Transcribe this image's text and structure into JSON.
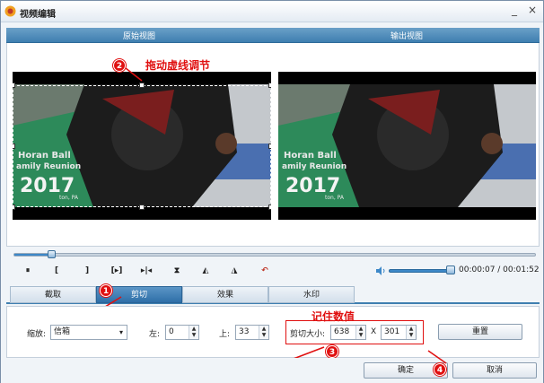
{
  "window": {
    "title": "视频编辑",
    "minimize_glyph": "_",
    "close_glyph": "×"
  },
  "view_header": {
    "original": "原始视图",
    "output": "输出视图"
  },
  "annotations": {
    "drag_text": "拖动虚线调节",
    "remember_text": "记住数值",
    "badge_1": "1",
    "badge_2": "2",
    "badge_3": "3",
    "badge_4": "4"
  },
  "video_frame": {
    "jersey_line1": "Horan  Ball",
    "jersey_line2": "amily Reunion",
    "jersey_year": "2017",
    "jersey_line3": "ton, PA"
  },
  "playback": {
    "progress": 0.07,
    "volume": 0.95,
    "time_text": "00:00:07 / 00:01:52",
    "buttons": [
      "⏸",
      "[",
      "]",
      "[▸]",
      "▸|◂",
      "⧗",
      "◭",
      "◮",
      "↶"
    ]
  },
  "tabs": [
    {
      "label": "截取",
      "active": false
    },
    {
      "label": "剪切",
      "active": true
    },
    {
      "label": "效果",
      "active": false
    },
    {
      "label": "水印",
      "active": false
    }
  ],
  "crop_panel": {
    "zoom_label": "缩放:",
    "zoom_value": "信箱",
    "left_label": "左:",
    "left_value": "0",
    "top_label": "上:",
    "top_value": "33",
    "size_label": "剪切大小:",
    "width_value": "638",
    "x_label": "X",
    "height_value": "301",
    "reset_label": "重置"
  },
  "footer": {
    "ok_label": "确定",
    "cancel_label": "取消"
  },
  "colors": {
    "accent": "#3f7fb0",
    "annotation": "#e01010"
  }
}
